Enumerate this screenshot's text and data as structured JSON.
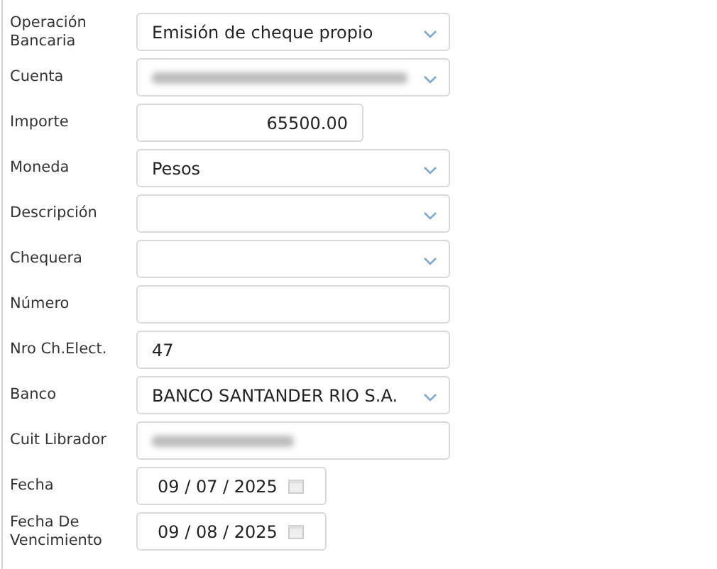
{
  "fields": [
    {
      "label": "Operación Bancaria",
      "kind": "select",
      "value": "Emisión de cheque propio"
    },
    {
      "label": "Cuenta",
      "kind": "blurred-select"
    },
    {
      "label": "Importe",
      "kind": "number",
      "value": "65500.00"
    },
    {
      "label": "Moneda",
      "kind": "select",
      "value": "Pesos"
    },
    {
      "label": "Descripción",
      "kind": "select"
    },
    {
      "label": "Chequera",
      "kind": "select"
    },
    {
      "label": "Número",
      "kind": "text"
    },
    {
      "label": "Nro Ch.Elect.",
      "kind": "text",
      "value": "47"
    },
    {
      "label": "Banco",
      "kind": "select",
      "value": "BANCO SANTANDER RIO S.A."
    },
    {
      "label": "Cuit Librador",
      "kind": "blurred-text"
    },
    {
      "label": "Fecha",
      "kind": "date",
      "value": "09 / 07 / 2025"
    },
    {
      "label": "Fecha De Vencimiento",
      "kind": "date",
      "value": "09 / 08 / 2025"
    }
  ]
}
